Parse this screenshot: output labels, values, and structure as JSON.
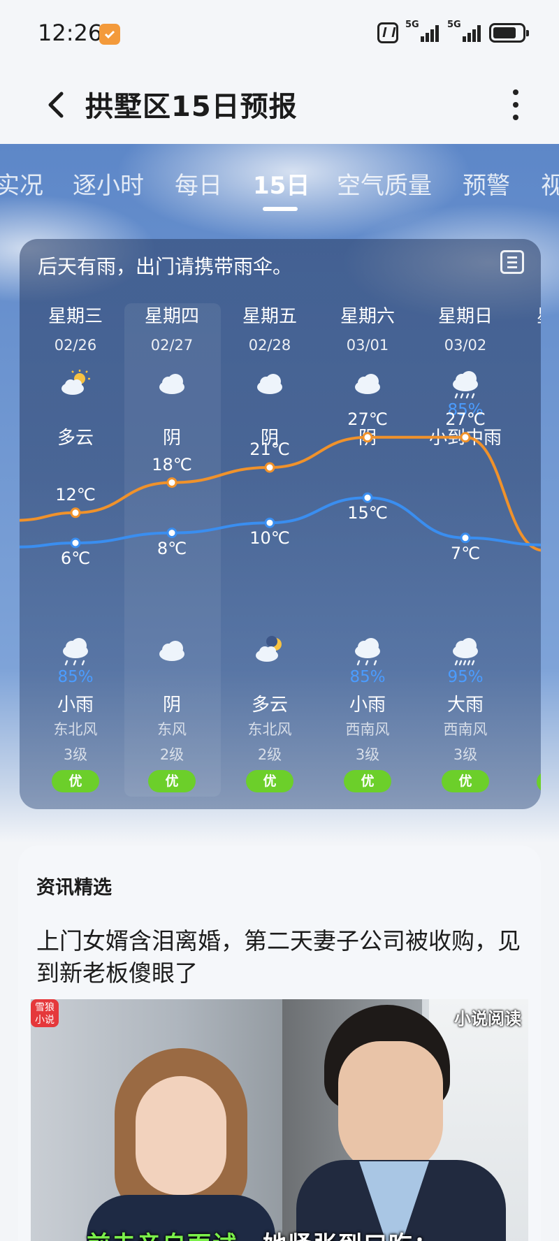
{
  "status_bar": {
    "time": "12:26",
    "net1": "5G",
    "net2": "5G"
  },
  "header": {
    "title": "拱墅区15日预报"
  },
  "tabs": [
    "实况",
    "逐小时",
    "每日",
    "15日",
    "空气质量",
    "预警",
    "视"
  ],
  "active_tab": "15日",
  "forecast": {
    "alert": "后天有雨，出门请携带雨伞。",
    "days": [
      {
        "name": "星期三",
        "date": "02/26",
        "day_icon": "partly-cloudy-sun-icon",
        "day_precip": "",
        "day_weather": "多云",
        "high": "12℃",
        "low": "6℃",
        "night_icon": "light-rain-icon",
        "night_precip": "85%",
        "night_weather": "小雨",
        "wind_dir": "东北风",
        "wind_level": "3级",
        "aqi": "优"
      },
      {
        "name": "星期四",
        "date": "02/27",
        "day_icon": "cloudy-icon",
        "day_precip": "",
        "day_weather": "阴",
        "high": "18℃",
        "low": "8℃",
        "night_icon": "cloudy-icon",
        "night_precip": "",
        "night_weather": "阴",
        "wind_dir": "东风",
        "wind_level": "2级",
        "aqi": "优"
      },
      {
        "name": "星期五",
        "date": "02/28",
        "day_icon": "cloudy-icon",
        "day_precip": "",
        "day_weather": "阴",
        "high": "21℃",
        "low": "10℃",
        "night_icon": "partly-cloudy-moon-icon",
        "night_precip": "",
        "night_weather": "多云",
        "wind_dir": "东北风",
        "wind_level": "2级",
        "aqi": "优"
      },
      {
        "name": "星期六",
        "date": "03/01",
        "day_icon": "cloudy-icon",
        "day_precip": "",
        "day_weather": "阴",
        "high": "27℃",
        "low": "15℃",
        "night_icon": "light-rain-icon",
        "night_precip": "85%",
        "night_weather": "小雨",
        "wind_dir": "西南风",
        "wind_level": "3级",
        "aqi": "优"
      },
      {
        "name": "星期日",
        "date": "03/02",
        "day_icon": "rain-icon",
        "day_precip": "85%",
        "day_weather": "小到中雨",
        "high": "27℃",
        "low": "7℃",
        "night_icon": "heavy-rain-icon",
        "night_precip": "95%",
        "night_weather": "大雨",
        "wind_dir": "西南风",
        "wind_level": "3级",
        "aqi": "优"
      }
    ],
    "partial_next_day": "星",
    "high_temps": [
      12,
      18,
      21,
      27,
      27
    ],
    "low_temps": [
      6,
      8,
      10,
      15,
      7
    ],
    "high_line_color": "#f0922b",
    "low_line_color": "#3a8ef0"
  },
  "news": {
    "section_title": "资讯精选",
    "headline": "上门女婿含泪离婚，第二天妻子公司被收购，见到新老板傻眼了",
    "image_logo": "雪狼小说",
    "image_tag": "小说阅读",
    "caption_green": "前夫亲自面试，",
    "caption_white": "她紧张到口吃："
  }
}
